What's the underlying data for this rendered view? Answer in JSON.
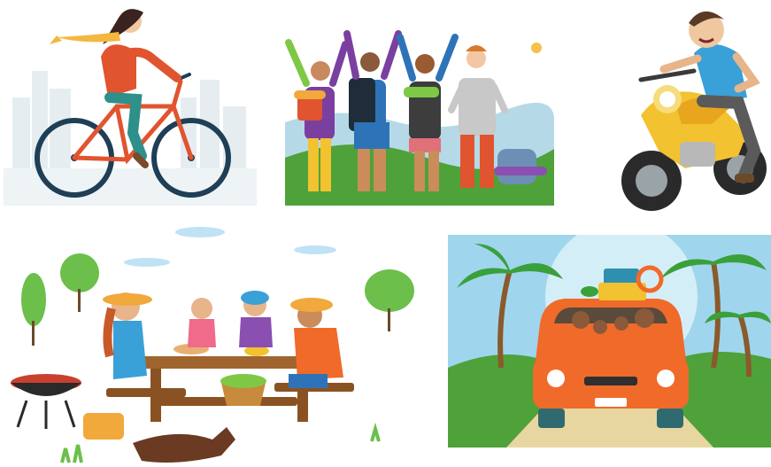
{
  "collage": {
    "panels": [
      {
        "subject": "cyclist-icon",
        "accent": "#e0542f"
      },
      {
        "subject": "hikers-icon",
        "accent": "#3f8e3a"
      },
      {
        "subject": "motorcycle-rider-icon",
        "accent": "#f2c230"
      },
      {
        "subject": "family-picnic-icon",
        "accent": "#f0a93a"
      },
      {
        "subject": "family-road-trip-icon",
        "accent": "#f06a2a"
      }
    ]
  }
}
